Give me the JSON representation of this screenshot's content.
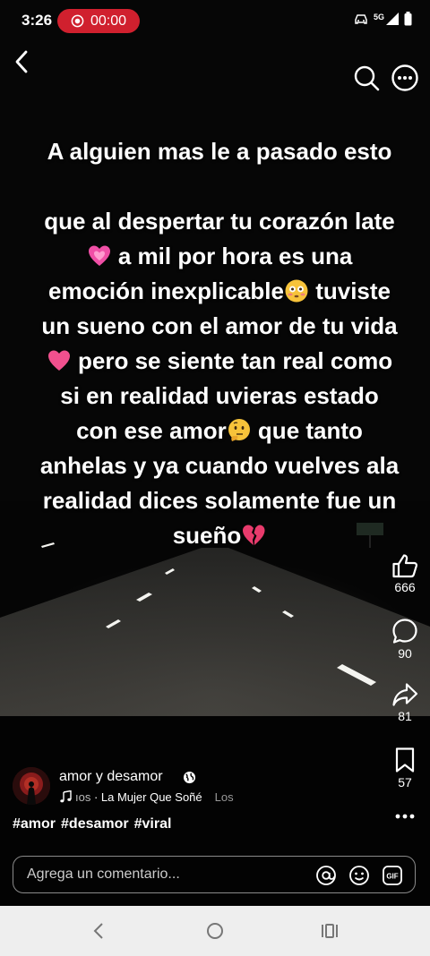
{
  "status_bar": {
    "time": "3:26",
    "recording_time": "00:00",
    "network_label": "5G",
    "icons": [
      "screen-record-icon",
      "car-icon",
      "signal-icon",
      "battery-icon"
    ]
  },
  "post": {
    "lines_first": [
      "A alguien mas le a pasado esto"
    ],
    "lines_body": [
      {
        "text": "que al despertar tu corazón late"
      },
      {
        "emoji": "growing-heart-icon",
        "text": " a mil por hora es una"
      },
      {
        "text": "emoción inexplicable",
        "emoji_after": "flushed-face-icon",
        "text_after": " tuviste"
      },
      {
        "text": "un sueno con el amor de tu vida"
      },
      {
        "emoji": "heart-icon",
        "text": " pero se siente tan real como"
      },
      {
        "text": "si en realidad uvieras estado"
      },
      {
        "text": "con ese amor",
        "emoji_after": "thinking-face-icon",
        "text_after": " que tanto"
      },
      {
        "text": "anhelas y ya cuando vuelves ala"
      },
      {
        "text": "realidad dices solamente fue un"
      },
      {
        "text": "sueño",
        "emoji_after": "broken-heart-icon"
      }
    ]
  },
  "actions": {
    "likes": "666",
    "comments": "90",
    "shares": "81",
    "saves": "57"
  },
  "author": {
    "name": "amor y desamor",
    "audio_prefix": "ıos",
    "audio_title": " · La Mujer Que Soñé",
    "audio_suffix": "Los"
  },
  "hashtags": [
    "#amor",
    "#desamor",
    "#viral"
  ],
  "comment": {
    "placeholder": "Agrega un comentario..."
  },
  "colors": {
    "record_pill": "#d0202e",
    "background": "#000000",
    "navbar": "#eeeeee"
  }
}
